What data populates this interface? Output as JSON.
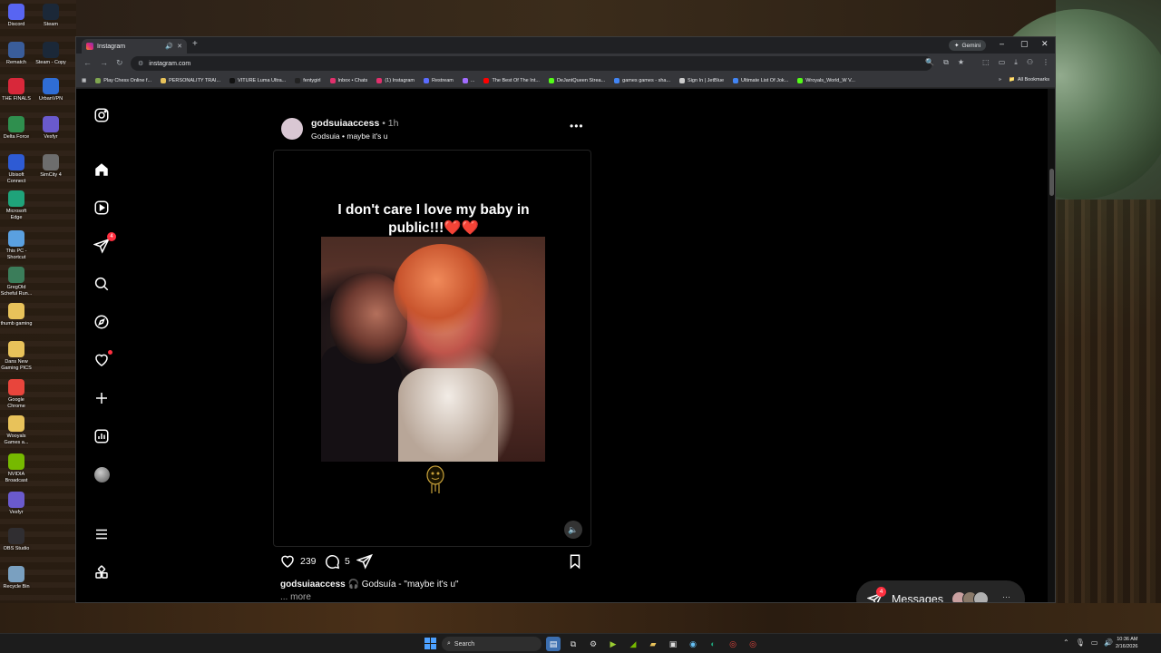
{
  "desktop": {
    "icons": [
      {
        "label": "Discord",
        "icon": "discord-icon",
        "color": "#5865f2"
      },
      {
        "label": "Steam",
        "icon": "steam-icon",
        "color": "#1b2838"
      },
      {
        "label": "Rematch",
        "icon": "rematch-icon",
        "color": "#3a5d9a"
      },
      {
        "label": "Steam - Copy",
        "icon": "steam-icon",
        "color": "#1b2838"
      },
      {
        "label": "THE FINALS",
        "icon": "the-finals-icon",
        "color": "#d8283a"
      },
      {
        "label": "UrbanVPN",
        "icon": "urbanvpn-icon",
        "color": "#2f6dd5"
      },
      {
        "label": "Delta Force",
        "icon": "delta-force-icon",
        "color": "#2f8f4e"
      },
      {
        "label": "Vesfyr",
        "icon": "vesfyr-icon",
        "color": "#6a5acd"
      },
      {
        "label": "Ubisoft Connect",
        "icon": "ubisoft-icon",
        "color": "#2e5bd4"
      },
      {
        "label": "SimCity 4",
        "icon": "simcity-icon",
        "color": "#6d6d6d"
      },
      {
        "label": "Microsoft Edge",
        "icon": "edge-icon",
        "color": "#1fa37a"
      },
      {
        "label": "This PC - Shortcut",
        "icon": "this-pc-icon",
        "color": "#5aa0e0"
      },
      {
        "label": "GregOld Scheful Run...",
        "icon": "app-icon",
        "color": "#3b7d5a"
      },
      {
        "label": "thumb gaming",
        "icon": "folder-icon",
        "color": "#e8c25a"
      },
      {
        "label": "Dans New Gaming PICS",
        "icon": "folder-icon",
        "color": "#e8c25a"
      },
      {
        "label": "Google Chrome",
        "icon": "chrome-icon",
        "color": "#e8453c"
      },
      {
        "label": "Wooyals Games a...",
        "icon": "folder-icon",
        "color": "#e8c25a"
      },
      {
        "label": "NVIDIA Broadcast",
        "icon": "nvidia-icon",
        "color": "#76b900"
      },
      {
        "label": "Vesfyr",
        "icon": "vesfyr-icon",
        "color": "#6a5acd"
      },
      {
        "label": "OBS Studio",
        "icon": "obs-icon",
        "color": "#302e31"
      },
      {
        "label": "Recycle Bin",
        "icon": "recycle-bin-icon",
        "color": "#7aa0c0"
      }
    ]
  },
  "browser": {
    "tab_title": "Instagram",
    "new_tab": "+",
    "gemini_label": "Gemini",
    "url": "instagram.com",
    "bookmarks": [
      {
        "label": "Play Chess Online f...",
        "color": "#7fa650"
      },
      {
        "label": "PERSONALITY TRAI...",
        "color": "#e8c25a"
      },
      {
        "label": "VITURE Luma Ultra...",
        "color": "#111111"
      },
      {
        "label": "fentygirl",
        "color": "#222222"
      },
      {
        "label": "Inbox • Chats",
        "color": "#e1306c"
      },
      {
        "label": "(1) Instagram",
        "color": "#e1306c"
      },
      {
        "label": "Restream",
        "color": "#5b6cff"
      },
      {
        "label": "...",
        "color": "#a26cff"
      },
      {
        "label": "The Best Of The Int...",
        "color": "#ff0000"
      },
      {
        "label": "DeJantQueen Strea...",
        "color": "#53fc18"
      },
      {
        "label": "games games - sha...",
        "color": "#4285f4"
      },
      {
        "label": "Sign In | JetBlue",
        "color": "#cccccc"
      },
      {
        "label": "Ultimate List Of Jok...",
        "color": "#4285f4"
      },
      {
        "label": "Wroyals_World_W V...",
        "color": "#53fc18"
      }
    ],
    "bookmarks_overflow": "»",
    "all_bookmarks": "All Bookmarks"
  },
  "instagram": {
    "nav": {
      "messages_badge": "4"
    },
    "post": {
      "username": "godsuiaaccess",
      "time": "• 1h",
      "audio": "Godsuia • maybe it's u",
      "overlay_text": "I don't care I love my baby in public!!!❤️❤️",
      "likes": "239",
      "comments": "5",
      "caption_user": "godsuiaaccess",
      "caption_text": "🎧 Godsuía - \"maybe it's u\"",
      "more": "... more"
    },
    "messages": {
      "label": "Messages",
      "badge": "4",
      "more": "···",
      "avatar_colors": [
        "#c9a0a0",
        "#8a7a6a",
        "#b0b0b0"
      ]
    }
  },
  "taskbar": {
    "search_placeholder": "Search",
    "time": "10:36 AM",
    "date": "2/16/2026"
  }
}
